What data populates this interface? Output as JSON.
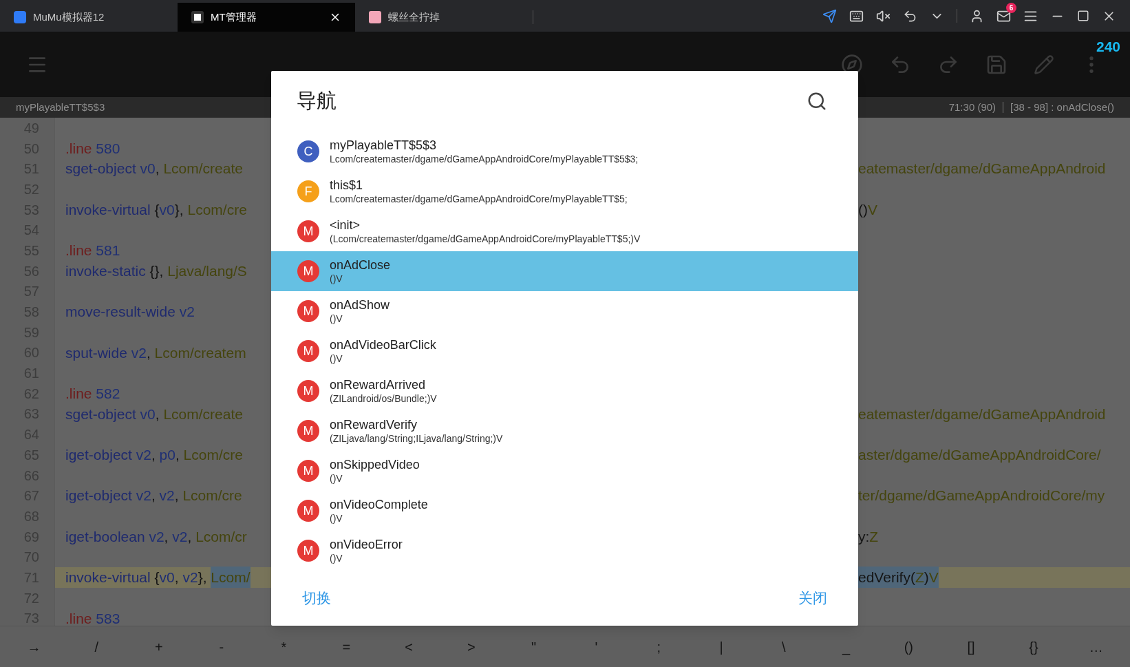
{
  "tabs": [
    {
      "label": "MuMu模拟器12",
      "selected": false
    },
    {
      "label": "MT管理器",
      "selected": true
    },
    {
      "label": "螺丝全拧掉",
      "selected": false
    }
  ],
  "mail_badge": "6",
  "fps": "240",
  "status_bar": {
    "file": "myPlayableTT$5$3",
    "position": "71:30 (90)",
    "range": "[38 - 98] : onAdClose()"
  },
  "code_lines": [
    {
      "number": "49",
      "current": false
    },
    {
      "number": "50",
      "current": false,
      "left": [
        {
          "text": ".line",
          "kind": "directive"
        },
        {
          "text": " 580",
          "kind": "number"
        }
      ]
    },
    {
      "number": "51",
      "current": false,
      "left": [
        {
          "text": "sget-object",
          "kind": "op"
        },
        {
          "text": " v0",
          "kind": "reg"
        },
        {
          "text": ", ",
          "kind": "punct"
        },
        {
          "text": "Lcom/create",
          "kind": "type"
        }
      ],
      "right": [
        {
          "text": "eatemaster/dgame/dGameAppAndroid",
          "kind": "type"
        }
      ]
    },
    {
      "number": "52",
      "current": false
    },
    {
      "number": "53",
      "current": false,
      "left": [
        {
          "text": "invoke-virtual",
          "kind": "op"
        },
        {
          "text": " {",
          "kind": "punct"
        },
        {
          "text": "v0",
          "kind": "reg"
        },
        {
          "text": "}, ",
          "kind": "punct"
        },
        {
          "text": "Lcom/cre",
          "kind": "type"
        }
      ],
      "right": [
        {
          "text": "()",
          "kind": "punct"
        },
        {
          "text": "V",
          "kind": "type"
        }
      ]
    },
    {
      "number": "54",
      "current": false
    },
    {
      "number": "55",
      "current": false,
      "left": [
        {
          "text": ".line",
          "kind": "directive"
        },
        {
          "text": " 581",
          "kind": "number"
        }
      ]
    },
    {
      "number": "56",
      "current": false,
      "left": [
        {
          "text": "invoke-static",
          "kind": "op"
        },
        {
          "text": " {}, ",
          "kind": "punct"
        },
        {
          "text": "Ljava/lang/S",
          "kind": "type"
        }
      ]
    },
    {
      "number": "57",
      "current": false
    },
    {
      "number": "58",
      "current": false,
      "left": [
        {
          "text": "move-result-wide",
          "kind": "op"
        },
        {
          "text": " v2",
          "kind": "reg"
        }
      ]
    },
    {
      "number": "59",
      "current": false
    },
    {
      "number": "60",
      "current": false,
      "left": [
        {
          "text": "sput-wide",
          "kind": "op"
        },
        {
          "text": " v2",
          "kind": "reg"
        },
        {
          "text": ", ",
          "kind": "punct"
        },
        {
          "text": "Lcom/createm",
          "kind": "type"
        }
      ]
    },
    {
      "number": "61",
      "current": false
    },
    {
      "number": "62",
      "current": false,
      "left": [
        {
          "text": ".line",
          "kind": "directive"
        },
        {
          "text": " 582",
          "kind": "number"
        }
      ]
    },
    {
      "number": "63",
      "current": false,
      "left": [
        {
          "text": "sget-object",
          "kind": "op"
        },
        {
          "text": " v0",
          "kind": "reg"
        },
        {
          "text": ", ",
          "kind": "punct"
        },
        {
          "text": "Lcom/create",
          "kind": "type"
        }
      ],
      "right": [
        {
          "text": "eatemaster/dgame/dGameAppAndroid",
          "kind": "type"
        }
      ]
    },
    {
      "number": "64",
      "current": false
    },
    {
      "number": "65",
      "current": false,
      "left": [
        {
          "text": "iget-object",
          "kind": "op"
        },
        {
          "text": " v2",
          "kind": "reg"
        },
        {
          "text": ", ",
          "kind": "punct"
        },
        {
          "text": "p0",
          "kind": "reg"
        },
        {
          "text": ", ",
          "kind": "punct"
        },
        {
          "text": "Lcom/cre",
          "kind": "type"
        }
      ],
      "right": [
        {
          "text": "aster/dgame/dGameAppAndroidCore/",
          "kind": "type"
        }
      ]
    },
    {
      "number": "66",
      "current": false
    },
    {
      "number": "67",
      "current": false,
      "left": [
        {
          "text": "iget-object",
          "kind": "op"
        },
        {
          "text": " v2",
          "kind": "reg"
        },
        {
          "text": ", ",
          "kind": "punct"
        },
        {
          "text": "v2",
          "kind": "reg"
        },
        {
          "text": ", ",
          "kind": "punct"
        },
        {
          "text": "Lcom/cre",
          "kind": "type"
        }
      ],
      "right": [
        {
          "text": "ter/dgame/dGameAppAndroidCore/my",
          "kind": "type"
        }
      ]
    },
    {
      "number": "68",
      "current": false
    },
    {
      "number": "69",
      "current": false,
      "left": [
        {
          "text": "iget-boolean",
          "kind": "op"
        },
        {
          "text": " v2",
          "kind": "reg"
        },
        {
          "text": ", ",
          "kind": "punct"
        },
        {
          "text": "v2",
          "kind": "reg"
        },
        {
          "text": ", ",
          "kind": "punct"
        },
        {
          "text": "Lcom/cr",
          "kind": "type"
        }
      ],
      "right": [
        {
          "text": "y:",
          "kind": "punct"
        },
        {
          "text": "Z",
          "kind": "type"
        }
      ]
    },
    {
      "number": "70",
      "current": false
    },
    {
      "number": "71",
      "current": true,
      "left": [
        {
          "text": "invoke-virtual",
          "kind": "op"
        },
        {
          "text": " {",
          "kind": "punct"
        },
        {
          "text": "v0",
          "kind": "reg"
        },
        {
          "text": ", ",
          "kind": "punct"
        },
        {
          "text": "v2",
          "kind": "reg"
        },
        {
          "text": "}, ",
          "kind": "punct"
        },
        {
          "text": "Lcom/",
          "kind": "type",
          "selected": true
        }
      ],
      "right": [
        {
          "text": "edVerify",
          "kind": "punct",
          "selected": true
        },
        {
          "text": "(",
          "kind": "punct",
          "selected": true
        },
        {
          "text": "Z",
          "kind": "type",
          "selected": true
        },
        {
          "text": ")",
          "kind": "punct",
          "selected": true
        },
        {
          "text": "V",
          "kind": "type",
          "selected": true
        }
      ]
    },
    {
      "number": "72",
      "current": false
    },
    {
      "number": "73",
      "current": false,
      "left": [
        {
          "text": ".line",
          "kind": "directive"
        },
        {
          "text": " 583",
          "kind": "number"
        }
      ]
    }
  ],
  "keys": [
    "→",
    "/",
    "+",
    "-",
    "*",
    "=",
    "<",
    ">",
    "\"",
    "'",
    ";",
    "|",
    "\\",
    "_",
    "()",
    "[]",
    "{}",
    "…"
  ],
  "dialog": {
    "title": "导航",
    "items": [
      {
        "badge": "C",
        "color": "#3f5fbf",
        "name": "myPlayableTT$5$3",
        "signature": "Lcom/createmaster/dgame/dGameAppAndroidCore/myPlayableTT$5$3;",
        "selected": false
      },
      {
        "badge": "F",
        "color": "#f5a01a",
        "name": "this$1",
        "signature": "Lcom/createmaster/dgame/dGameAppAndroidCore/myPlayableTT$5;",
        "selected": false
      },
      {
        "badge": "M",
        "color": "#e53935",
        "name": "<init>",
        "signature": "(Lcom/createmaster/dgame/dGameAppAndroidCore/myPlayableTT$5;)V",
        "selected": false
      },
      {
        "badge": "M",
        "color": "#e53935",
        "name": "onAdClose",
        "signature": "()V",
        "selected": true
      },
      {
        "badge": "M",
        "color": "#e53935",
        "name": "onAdShow",
        "signature": "()V",
        "selected": false
      },
      {
        "badge": "M",
        "color": "#e53935",
        "name": "onAdVideoBarClick",
        "signature": "()V",
        "selected": false
      },
      {
        "badge": "M",
        "color": "#e53935",
        "name": "onRewardArrived",
        "signature": "(ZILandroid/os/Bundle;)V",
        "selected": false
      },
      {
        "badge": "M",
        "color": "#e53935",
        "name": "onRewardVerify",
        "signature": "(ZILjava/lang/String;ILjava/lang/String;)V",
        "selected": false
      },
      {
        "badge": "M",
        "color": "#e53935",
        "name": "onSkippedVideo",
        "signature": "()V",
        "selected": false
      },
      {
        "badge": "M",
        "color": "#e53935",
        "name": "onVideoComplete",
        "signature": "()V",
        "selected": false
      },
      {
        "badge": "M",
        "color": "#e53935",
        "name": "onVideoError",
        "signature": "()V",
        "selected": false
      }
    ],
    "buttons": [
      "切换",
      "关闭"
    ]
  }
}
